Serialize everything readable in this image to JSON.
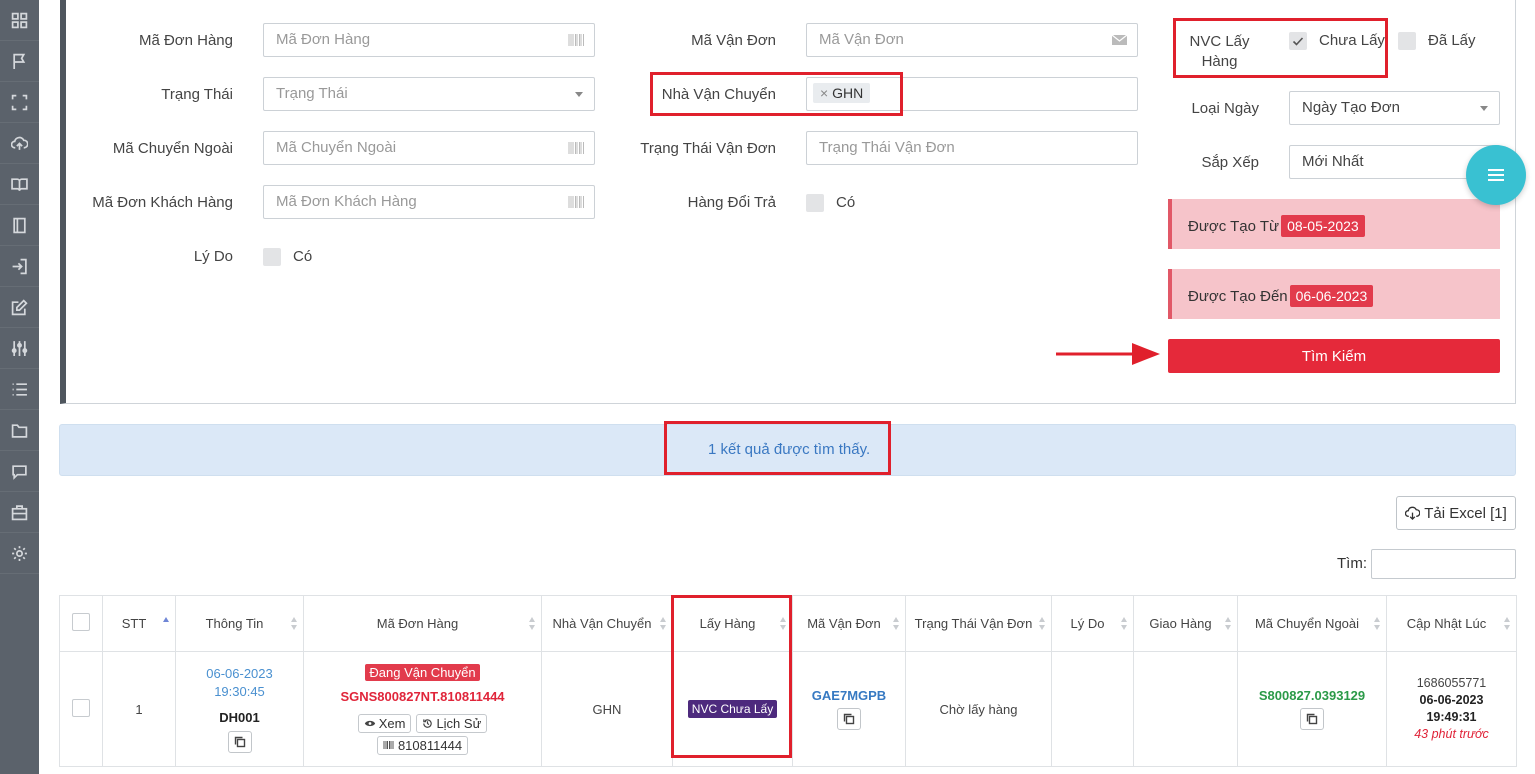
{
  "sidebar": {
    "icons": [
      "grid-icon",
      "flag-icon",
      "expand-icon",
      "cloud-upload-icon",
      "book-icon",
      "notebook-icon",
      "sign-in-icon",
      "edit-icon",
      "sliders-icon",
      "list-icon",
      "folder-icon",
      "chat-icon",
      "briefcase-icon",
      "settings-icon"
    ]
  },
  "filters": {
    "order_code_label": "Mã Đơn Hàng",
    "order_code_placeholder": "Mã Đơn Hàng",
    "status_label": "Trạng Thái",
    "status_placeholder": "Trạng Thái",
    "ext_code_label": "Mã Chuyển Ngoài",
    "ext_code_placeholder": "Mã Chuyển Ngoài",
    "customer_code_label": "Mã Đơn Khách Hàng",
    "customer_code_placeholder": "Mã Đơn Khách Hàng",
    "reason_label": "Lý Do",
    "reason_option": "Có",
    "waybill_label": "Mã Vận Đơn",
    "waybill_placeholder": "Mã Vận Đơn",
    "carrier_label": "Nhà Vận Chuyển",
    "carrier_tag": "GHN",
    "carrier_tag_remove": "×",
    "waybill_status_label": "Trạng Thái Vận Đơn",
    "waybill_status_placeholder": "Trạng Thái Vận Đơn",
    "return_label": "Hàng Đổi Trả",
    "return_option": "Có",
    "pickup_label_1": "NVC Lấy",
    "pickup_label_2": "Hàng",
    "pickup_not_picked": "Chưa Lấy",
    "pickup_picked": "Đã Lấy",
    "date_type_label": "Loại Ngày",
    "date_type_value": "Ngày Tạo Đơn",
    "sort_label": "Sắp Xếp",
    "sort_value": "Mới Nhất",
    "created_from_label": "Được Tạo Từ",
    "created_from_value": "08-05-2023",
    "created_to_label": "Được Tạo Đến",
    "created_to_value": "06-06-2023",
    "search_button": "Tìm Kiếm"
  },
  "results": {
    "message": "1 kết quả được tìm thấy.",
    "excel_button": "Tải Excel [1]",
    "find_label": "Tìm:"
  },
  "table": {
    "headers": [
      "STT",
      "Thông Tin",
      "Mã Đơn Hàng",
      "Nhà Vận Chuyển",
      "Lấy Hàng",
      "Mã Vận Đơn",
      "Trạng Thái Vận Đơn",
      "Lý Do",
      "Giao Hàng",
      "Mã Chuyển Ngoài",
      "Cập Nhật Lúc"
    ],
    "row": {
      "stt": "1",
      "info_date": "06-06-2023",
      "info_time": "19:30:45",
      "info_code": "DH001",
      "order_status": "Đang Vận Chuyển",
      "order_code": "SGNS800827NT.810811444",
      "view_button": "Xem",
      "history_button": "Lịch Sử",
      "barcode": "810811444",
      "carrier": "GHN",
      "pickup": "NVC Chưa Lấy",
      "waybill": "GAE7MGPB",
      "waybill_status": "Chờ lấy hàng",
      "reason": "",
      "delivery": "",
      "ext_code": "S800827.0393129",
      "updated_ts": "1686055771",
      "updated_date": "06-06-2023",
      "updated_time": "19:49:31",
      "updated_ago": "43 phút trước"
    }
  },
  "colors": {
    "accent_red": "#e5293a",
    "sidebar": "#5b626b",
    "highlight_box": "#e0202c",
    "fab": "#39c1d2",
    "pickup_badge": "#4d2a7d"
  }
}
